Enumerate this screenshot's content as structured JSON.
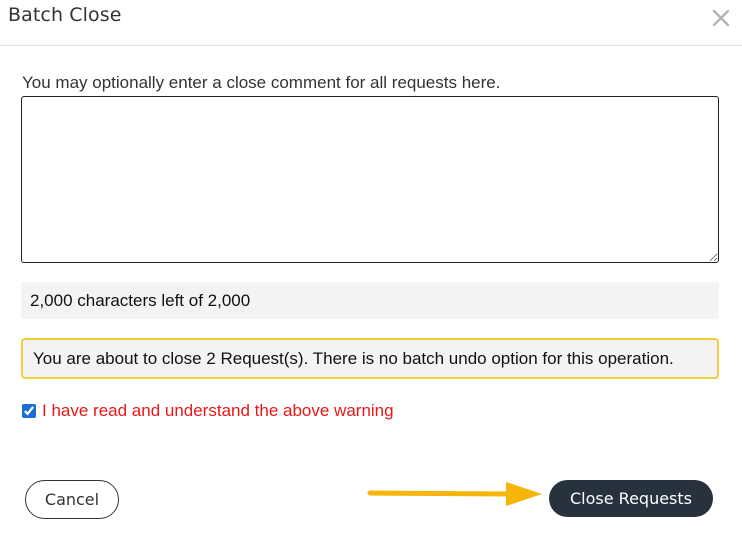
{
  "dialog": {
    "title": "Batch Close",
    "close_icon": "close-icon"
  },
  "comment": {
    "prompt": "You may optionally enter a close comment for all requests here.",
    "value": "",
    "counter_text": "2,000 characters left of 2,000"
  },
  "warning": {
    "text": "You are about to close 2 Request(s). There is no batch undo option for this operation.",
    "border_color": "#f2cf3a"
  },
  "acknowledge": {
    "checked": true,
    "label": "I have read and understand the above warning",
    "label_color": "#e81818"
  },
  "actions": {
    "cancel_label": "Cancel",
    "submit_label": "Close Requests",
    "submit_color": "#28323f"
  },
  "annotation": {
    "arrow_icon": "arrow-right-icon",
    "arrow_color": "#f5b50a"
  }
}
